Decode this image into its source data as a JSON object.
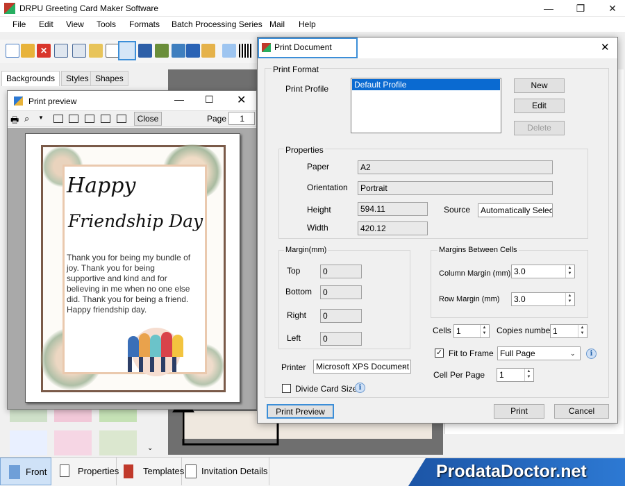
{
  "window": {
    "title": "DRPU Greeting Card Maker Software"
  },
  "menu": [
    "File",
    "Edit",
    "View",
    "Tools",
    "Formats",
    "Batch Processing Series",
    "Mail",
    "Help"
  ],
  "left_tabs": [
    "Backgrounds",
    "Styles",
    "Shapes"
  ],
  "print_preview": {
    "title": "Print preview",
    "close_label": "Close",
    "page_label": "Page",
    "page_value": "1"
  },
  "card": {
    "line1": "Happy",
    "line2": "Friendship Day",
    "message": "Thank you for being my bundle of joy. Thank you for being supportive and kind and for believing in me when no one else did. Thank you for being a friend. Happy friendship day."
  },
  "print_document": {
    "title": "Print Document",
    "print_format_label": "Print Format",
    "print_profile_label": "Print Profile",
    "profiles": [
      "Default Profile"
    ],
    "new_label": "New",
    "edit_label": "Edit",
    "delete_label": "Delete",
    "properties_label": "Properties",
    "paper_label": "Paper",
    "paper_value": "A2",
    "orientation_label": "Orientation",
    "orientation_value": "Portrait",
    "height_label": "Height",
    "height_value": "594.11",
    "width_label": "Width",
    "width_value": "420.12",
    "source_label": "Source",
    "source_value": "Automatically Selec",
    "margin_label": "Margin(mm)",
    "top_label": "Top",
    "top_value": "0",
    "bottom_label": "Bottom",
    "bottom_value": "0",
    "right_label": "Right",
    "right_value": "0",
    "left_label": "Left",
    "left_value": "0",
    "cells_margin_label": "Margins Between Cells",
    "column_margin_label": "Column Margin (mm)",
    "column_margin_value": "3.0",
    "row_margin_label": "Row Margin (mm)",
    "row_margin_value": "3.0",
    "cells_label": "Cells",
    "cells_value": "1",
    "copies_label": "Copies number",
    "copies_value": "1",
    "fit_to_frame_label": "Fit to Frame",
    "fit_to_frame_checked": true,
    "frame_option": "Full Page",
    "cell_per_page_label": "Cell Per Page",
    "cell_per_page_value": "1",
    "printer_label": "Printer",
    "printer_value": "Microsoft XPS Document",
    "divide_card_label": "Divide Card Size",
    "print_preview_label": "Print Preview",
    "print_label": "Print",
    "cancel_label": "Cancel"
  },
  "bottom_tabs": [
    "Front",
    "Properties",
    "Templates",
    "Invitation Details"
  ],
  "brand": "ProdataDoctor.net"
}
